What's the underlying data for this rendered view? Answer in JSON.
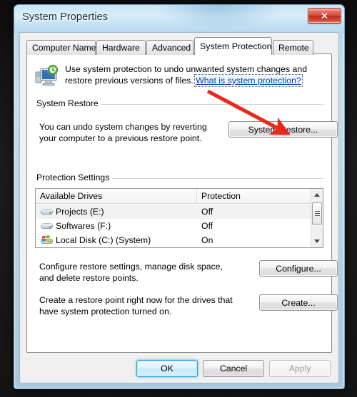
{
  "window": {
    "title": "System Properties",
    "close_icon": "close-icon",
    "close_label": "✕"
  },
  "tabs": [
    {
      "label": "Computer Name",
      "active": false
    },
    {
      "label": "Hardware",
      "active": false
    },
    {
      "label": "Advanced",
      "active": false
    },
    {
      "label": "System Protection",
      "active": true
    },
    {
      "label": "Remote",
      "active": false
    }
  ],
  "blurb": {
    "icon": "system-protection-icon",
    "line1": "Use system protection to undo unwanted system changes and",
    "line2": "restore previous versions of files.",
    "link": "What is system protection?"
  },
  "system_restore": {
    "group_label": "System Restore",
    "desc_line1": "You can undo system changes by reverting",
    "desc_line2": "your computer to a previous restore point.",
    "button_label": "System Restore..."
  },
  "protection_settings": {
    "group_label": "Protection Settings",
    "columns": [
      "Available Drives",
      "Protection"
    ],
    "drives": [
      {
        "icon": "drive-icon",
        "name": "Projects (E:)",
        "protection": "Off"
      },
      {
        "icon": "drive-icon",
        "name": "Softwares (F:)",
        "protection": "Off"
      },
      {
        "icon": "system-drive-icon",
        "name": "Local Disk (C:) (System)",
        "protection": "On"
      }
    ],
    "scroll_up_icon": "chevron-up-icon",
    "scroll_down_icon": "chevron-down-icon",
    "configure": {
      "desc_line1": "Configure restore settings, manage disk space,",
      "desc_line2": "and delete restore points.",
      "button_label": "Configure..."
    },
    "create": {
      "desc_line1": "Create a restore point right now for the drives that",
      "desc_line2": "have system protection turned on.",
      "button_label": "Create..."
    }
  },
  "dialog_buttons": {
    "ok": "OK",
    "cancel": "Cancel",
    "apply": "Apply"
  },
  "annotation": {
    "arrow_color": "#e8291c",
    "arrow_name": "red-pointer-arrow"
  },
  "colors": {
    "accent": "#2c9fd4",
    "link": "#0645ad",
    "close_red": "#d14433",
    "arrow_red": "#e8291c"
  }
}
